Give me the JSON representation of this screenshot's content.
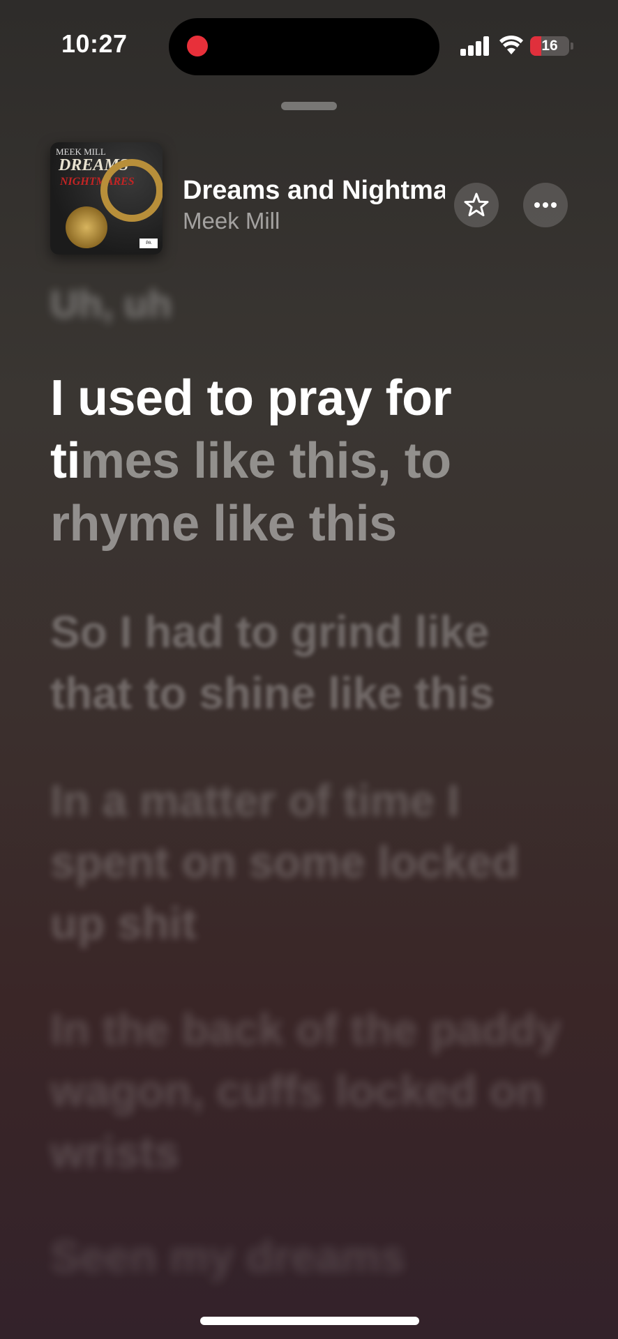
{
  "status": {
    "time": "10:27",
    "battery": "16",
    "colors": {
      "recording": "#e8303a",
      "battery_low": "#e0303c"
    }
  },
  "player": {
    "song_title": "Dreams and Nightma",
    "artist": "Meek Mill",
    "favorite_icon": "star-icon",
    "more_icon": "ellipsis-icon",
    "album_art": {
      "top_text": "MEEK MILL",
      "title_text": "DREAMS",
      "subtitle_text": "NIGHTMARES"
    }
  },
  "lyrics": {
    "previous": "Uh, uh",
    "current_sung": "I used to pray for ti",
    "current_unsung": "mes like this, to rhyme like this",
    "next": [
      "So I had to grind like that to shine like this",
      "In a matter of time I spent on some locked up shit",
      "In the back of the paddy wagon, cuffs locked on wrists",
      "Seen my dreams"
    ]
  }
}
